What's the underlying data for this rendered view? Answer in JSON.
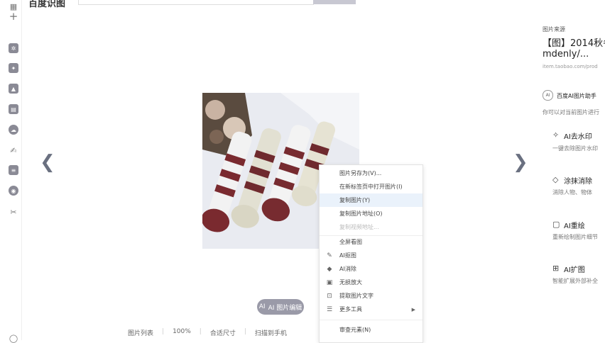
{
  "topbar": {
    "app_title": "百度识图"
  },
  "rail": {
    "icons": [
      "grid-icon",
      "plus-icon",
      "settings-icon",
      "star-icon",
      "photo-edit-icon",
      "document-icon",
      "cloud-icon",
      "sign-icon",
      "list-icon",
      "circle-icon",
      "scissors-icon"
    ]
  },
  "viewer": {
    "ai_button_label": "AI 图片编辑",
    "toolbar": {
      "image_list": "图片列表",
      "zoom": "100%",
      "fit": "合适尺寸",
      "scan": "扫描到手机"
    }
  },
  "context_menu": {
    "items": [
      {
        "label": "图片另存为(V)...",
        "icon": ""
      },
      {
        "label": "在新标签页中打开图片(I)",
        "icon": ""
      },
      {
        "label": "复制图片(Y)",
        "icon": ""
      },
      {
        "label": "复制图片地址(O)",
        "icon": ""
      },
      {
        "label": "复制视频地址...",
        "icon": ""
      },
      {
        "label": "全屏看图",
        "icon": ""
      },
      {
        "label": "AI抠图",
        "icon": "✎"
      },
      {
        "label": "AI消除",
        "icon": "◆"
      },
      {
        "label": "无损放大",
        "icon": "▣"
      },
      {
        "label": "提取图片文字",
        "icon": "⊡"
      },
      {
        "label": "更多工具",
        "icon": "☰"
      },
      {
        "label": "审查元素(N)",
        "icon": ""
      }
    ]
  },
  "right_panel": {
    "source_label": "图片来源",
    "title_line1": "【图】2014秋冬",
    "title_line2": "mdenly/...",
    "url": "item.taobao.com/prod",
    "assistant_title": "百度AI图片助手",
    "assistant_desc": "你可以对当前图片进行",
    "features": [
      {
        "title": "AI去水印",
        "desc": "一键去除图片水印",
        "icon": "✧"
      },
      {
        "title": "涂抹消除",
        "desc": "消除人物、物体",
        "icon": "◇"
      },
      {
        "title": "AI重绘",
        "desc": "重新绘制图片细节",
        "icon": "▢"
      },
      {
        "title": "AI扩图",
        "desc": "智能扩展外部补全",
        "icon": "⊞"
      }
    ]
  }
}
